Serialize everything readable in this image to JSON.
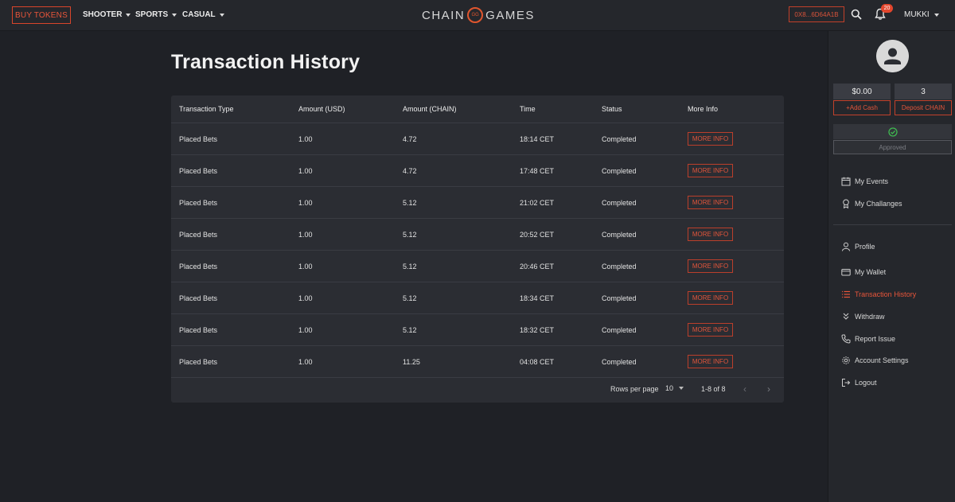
{
  "topbar": {
    "buy_tokens": "BUY TOKENS",
    "nav": [
      "SHOOTER",
      "SPORTS",
      "CASUAL"
    ],
    "logo_left": "CHAIN",
    "logo_mark": "GG",
    "logo_right": "GAMES",
    "wallet_address": "0X8...6D64A1B",
    "notification_count": "20",
    "username": "MUKKI"
  },
  "page": {
    "title": "Transaction History"
  },
  "table": {
    "columns": [
      "Transaction Type",
      "Amount (USD)",
      "Amount (CHAIN)",
      "Time",
      "Status",
      "More Info"
    ],
    "rows": [
      {
        "type": "Placed Bets",
        "usd": "1.00",
        "chain": "4.72",
        "time": "18:14 CET",
        "status": "Completed",
        "action": "MORE INFO"
      },
      {
        "type": "Placed Bets",
        "usd": "1.00",
        "chain": "4.72",
        "time": "17:48 CET",
        "status": "Completed",
        "action": "MORE INFO"
      },
      {
        "type": "Placed Bets",
        "usd": "1.00",
        "chain": "5.12",
        "time": "21:02 CET",
        "status": "Completed",
        "action": "MORE INFO"
      },
      {
        "type": "Placed Bets",
        "usd": "1.00",
        "chain": "5.12",
        "time": "20:52 CET",
        "status": "Completed",
        "action": "MORE INFO"
      },
      {
        "type": "Placed Bets",
        "usd": "1.00",
        "chain": "5.12",
        "time": "20:46 CET",
        "status": "Completed",
        "action": "MORE INFO"
      },
      {
        "type": "Placed Bets",
        "usd": "1.00",
        "chain": "5.12",
        "time": "18:34 CET",
        "status": "Completed",
        "action": "MORE INFO"
      },
      {
        "type": "Placed Bets",
        "usd": "1.00",
        "chain": "5.12",
        "time": "18:32 CET",
        "status": "Completed",
        "action": "MORE INFO"
      },
      {
        "type": "Placed Bets",
        "usd": "1.00",
        "chain": "11.25",
        "time": "04:08 CET",
        "status": "Completed",
        "action": "MORE INFO"
      }
    ],
    "pagination": {
      "rows_per_page_label": "Rows per page",
      "rows_per_page": "10",
      "range": "1-8 of 8",
      "prev": "‹",
      "next": "›"
    }
  },
  "sidebar": {
    "balance_usd": "$0.00",
    "balance_chain": "3",
    "add_cash": "+Add Cash",
    "deposit_chain": "Deposit CHAIN",
    "approved": "Approved",
    "menu": [
      {
        "label": "My Events",
        "icon": "calendar-icon"
      },
      {
        "label": "My Challanges",
        "icon": "award-icon"
      },
      {
        "label": "Profile",
        "icon": "user-icon"
      },
      {
        "label": "My Wallet",
        "icon": "wallet-icon"
      },
      {
        "label": "Transaction History",
        "icon": "list-icon"
      },
      {
        "label": "Withdraw",
        "icon": "double-chevron-down-icon"
      },
      {
        "label": "Report Issue",
        "icon": "phone-icon"
      },
      {
        "label": "Account Settings",
        "icon": "gear-icon"
      },
      {
        "label": "Logout",
        "icon": "logout-icon"
      }
    ]
  },
  "colors": {
    "accent": "#e2553b",
    "background": "#1f2126",
    "card": "#2b2d33",
    "approved_check": "#3fb950"
  }
}
